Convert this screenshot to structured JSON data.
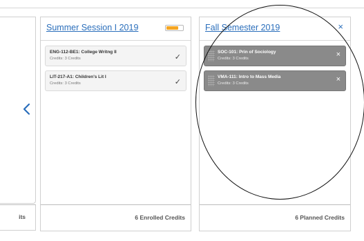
{
  "left_panel": {
    "footer_fragment": "its"
  },
  "summer": {
    "title": "Summer Session I 2019",
    "progress_fraction": 0.75,
    "progress_color": "#f5a623",
    "courses": [
      {
        "code": "ENG-112-BE1: College Writng II",
        "credits": "Credits: 3 Credits",
        "status_glyph": "✓"
      },
      {
        "code": "LIT-217-A1: Children's Lit I",
        "credits": "Credits: 3 Credits",
        "status_glyph": "✓"
      }
    ],
    "footer": "6 Enrolled Credits"
  },
  "fall": {
    "title": "Fall Semester 2019",
    "close_glyph": "×",
    "courses": [
      {
        "code": "SOC-101: Prin of Sociology",
        "credits": "Credits: 3 Credits",
        "remove_glyph": "×"
      },
      {
        "code": "VMA-111: Intro to Mass Media",
        "credits": "Credits: 3 Credits",
        "remove_glyph": "×"
      }
    ],
    "footer": "6 Planned Credits"
  },
  "colors": {
    "link": "#2a6ebb",
    "planned_card": "#8a8a8a",
    "enrolled_card": "#f4f4f4"
  },
  "icons": {
    "prev": "chevron-left-icon",
    "check": "check-icon",
    "remove": "close-icon",
    "drag": "drag-handle-icon"
  }
}
